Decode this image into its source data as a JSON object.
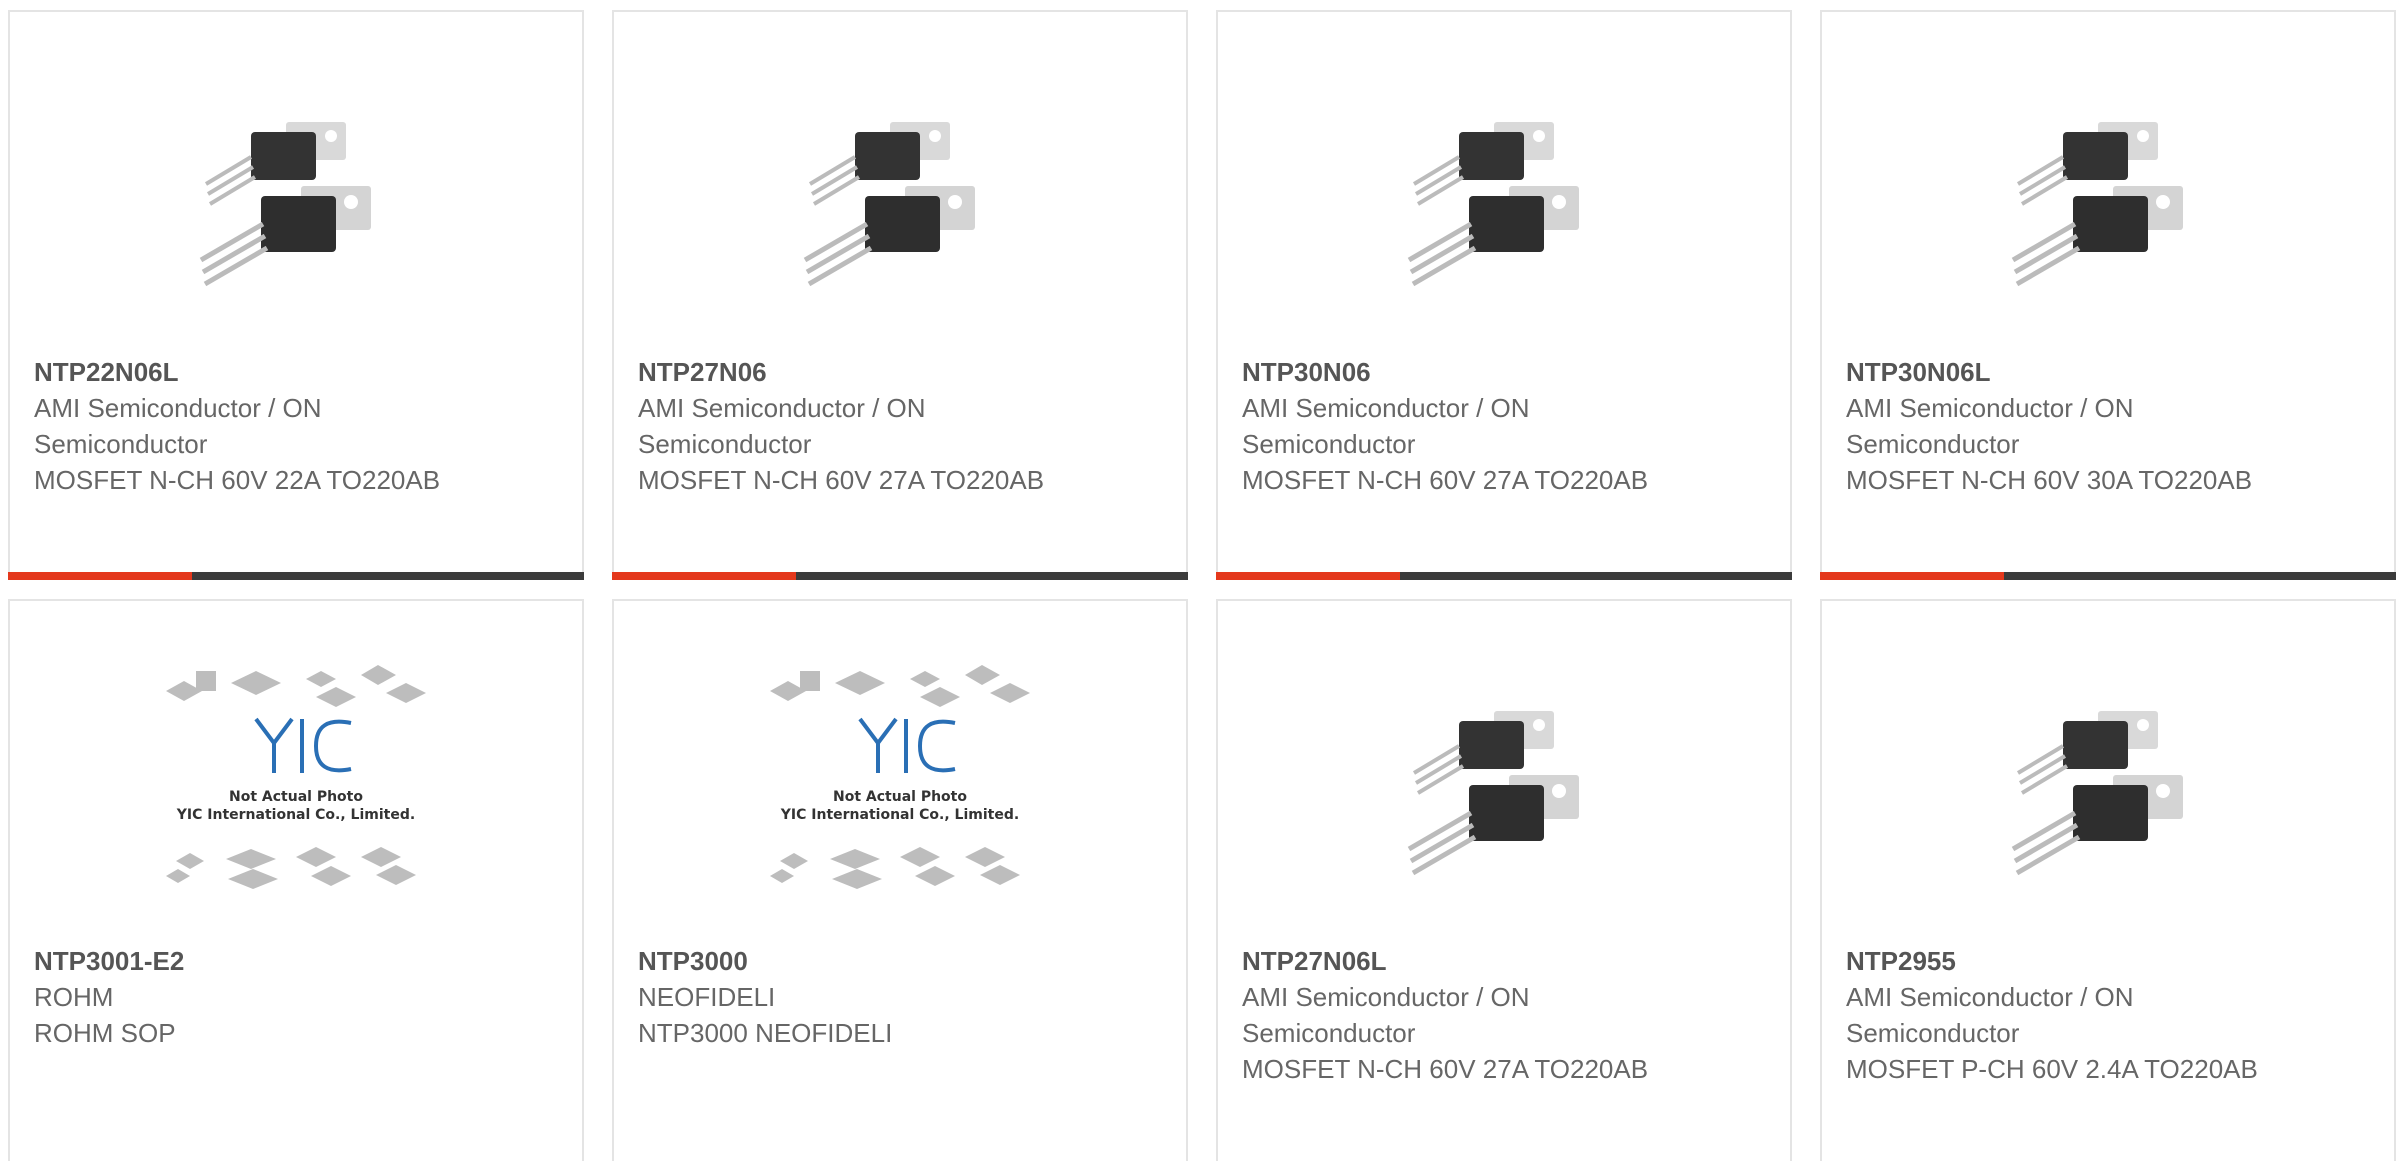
{
  "products": [
    {
      "part": "NTP22N06L",
      "manufacturer": "AMI Semiconductor / ON Semiconductor",
      "description": "MOSFET N-CH 60V 22A TO220AB",
      "image": "to220-package-photo"
    },
    {
      "part": "NTP27N06",
      "manufacturer": "AMI Semiconductor / ON Semiconductor",
      "description": "MOSFET N-CH 60V 27A TO220AB",
      "image": "to220-package-photo"
    },
    {
      "part": "NTP30N06",
      "manufacturer": "AMI Semiconductor / ON Semiconductor",
      "description": "MOSFET N-CH 60V 27A TO220AB",
      "image": "to220-package-photo"
    },
    {
      "part": "NTP30N06L",
      "manufacturer": "AMI Semiconductor / ON Semiconductor",
      "description": "MOSFET N-CH 60V 30A TO220AB",
      "image": "to220-package-photo"
    },
    {
      "part": "NTP3001-E2",
      "manufacturer": "ROHM",
      "description": "ROHM SOP",
      "image": "yic-placeholder-photo",
      "placeholder_line1": "Not Actual Photo",
      "placeholder_line2": "YIC International Co., Limited."
    },
    {
      "part": "NTP3000",
      "manufacturer": "NEOFIDELI",
      "description": "NTP3000 NEOFIDELI",
      "image": "yic-placeholder-photo",
      "placeholder_line1": "Not Actual Photo",
      "placeholder_line2": "YIC International Co., Limited."
    },
    {
      "part": "NTP27N06L",
      "manufacturer": "AMI Semiconductor / ON Semiconductor",
      "description": "MOSFET N-CH 60V 27A TO220AB",
      "image": "to220-package-photo"
    },
    {
      "part": "NTP2955",
      "manufacturer": "AMI Semiconductor / ON Semiconductor",
      "description": "MOSFET P-CH 60V 2.4A TO220AB",
      "image": "to220-package-photo"
    }
  ],
  "colors": {
    "accent": "#e4381c",
    "bar": "#3b3b3b",
    "border": "#e4e4e4",
    "text": "#666666",
    "yic_blue": "#2a6fb5"
  }
}
